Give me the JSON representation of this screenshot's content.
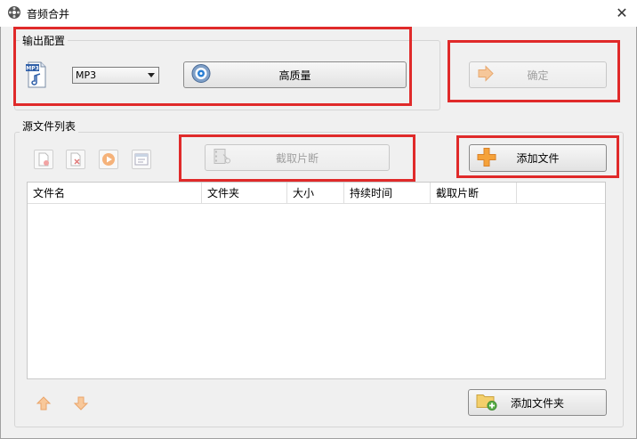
{
  "window": {
    "title": "音频合并",
    "close_glyph": "✕"
  },
  "output_config": {
    "legend": "输出配置",
    "format_icon_text": "MP3",
    "format_select": "MP3",
    "quality_button": "高质量"
  },
  "confirm_button": "确定",
  "source_list": {
    "legend": "源文件列表",
    "clip_button": "截取片断",
    "add_file_button": "添加文件",
    "columns": [
      "文件名",
      "文件夹",
      "大小",
      "持续时间",
      "截取片断"
    ]
  },
  "add_folder_button": "添加文件夹",
  "colors": {
    "highlight": "#e02a2a",
    "accent_orange": "#f5a23a"
  }
}
